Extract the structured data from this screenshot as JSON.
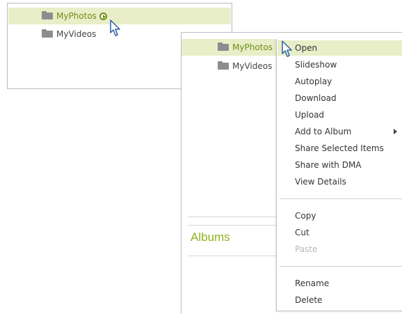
{
  "panel_a": {
    "folders": [
      {
        "label": "MyPhotos"
      },
      {
        "label": "MyVideos"
      }
    ]
  },
  "panel_b": {
    "folders": [
      {
        "label": "MyPhotos"
      },
      {
        "label": "MyVideos"
      }
    ],
    "section_title": "Albums"
  },
  "context_menu": {
    "items": [
      {
        "label": "Open"
      },
      {
        "label": "Slideshow"
      },
      {
        "label": "Autoplay"
      },
      {
        "label": "Download"
      },
      {
        "label": "Upload"
      },
      {
        "label": "Add to Album"
      },
      {
        "label": "Share Selected Items"
      },
      {
        "label": "Share with DMA"
      },
      {
        "label": "View Details"
      },
      {
        "label": "Copy"
      },
      {
        "label": "Cut"
      },
      {
        "label": "Paste"
      },
      {
        "label": "Rename"
      },
      {
        "label": "Delete"
      }
    ]
  },
  "colors": {
    "accent_green": "#8cb31a",
    "label_green": "#6f8f16",
    "selection_bg": "#e8eec8",
    "folder_gray": "#8d8d8d",
    "disabled_text": "#b9b9b9"
  },
  "icons": {
    "folder": "folder-icon",
    "play": "play-icon",
    "cursor": "cursor-icon",
    "submenu": "submenu-arrow-icon"
  }
}
